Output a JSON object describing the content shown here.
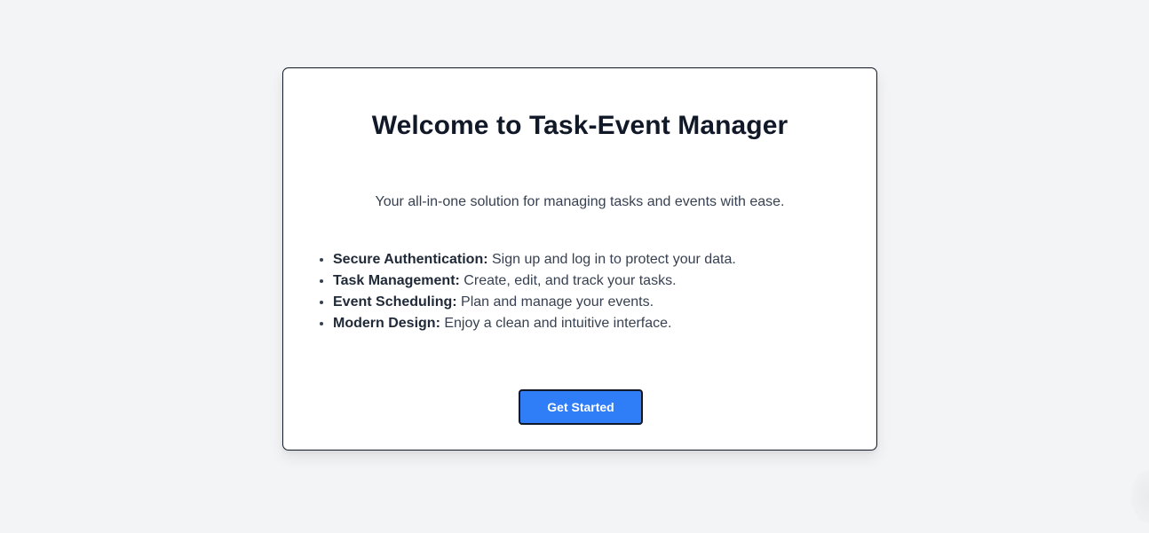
{
  "card": {
    "title": "Welcome to Task-Event Manager",
    "subtitle": "Your all-in-one solution for managing tasks and events with ease.",
    "features": [
      {
        "label": "Secure Authentication:",
        "text": " Sign up and log in to protect your data."
      },
      {
        "label": "Task Management:",
        "text": " Create, edit, and track your tasks."
      },
      {
        "label": "Event Scheduling:",
        "text": " Plan and manage your events."
      },
      {
        "label": "Modern Design:",
        "text": " Enjoy a clean and intuitive interface."
      }
    ],
    "cta_label": "Get Started"
  },
  "colors": {
    "page_background": "#f3f4f6",
    "card_background": "#ffffff",
    "accent": "#2f7ef7",
    "heading_text": "#111827",
    "body_text": "#374151"
  }
}
